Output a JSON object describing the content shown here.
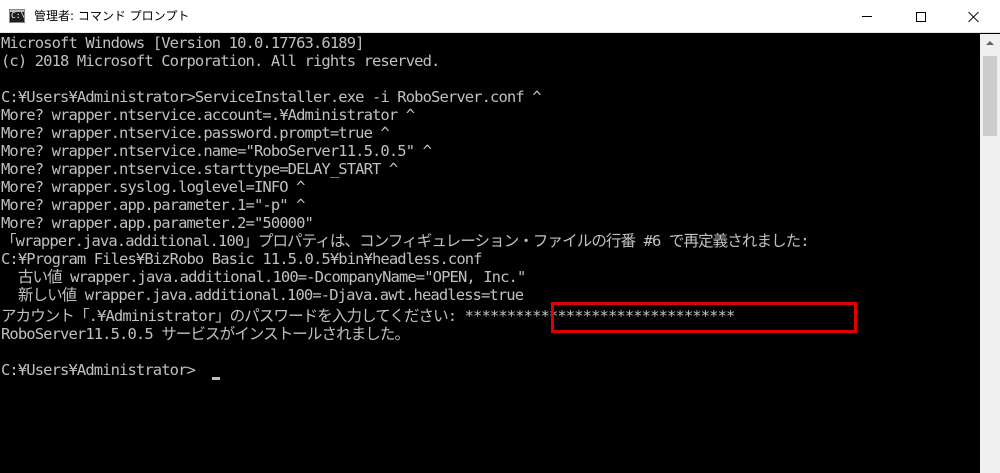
{
  "window": {
    "title": "管理者: コマンド プロンプト",
    "icon_label": "C:\\"
  },
  "console": {
    "lines": [
      "Microsoft Windows [Version 10.0.17763.6189]",
      "(c) 2018 Microsoft Corporation. All rights reserved.",
      "",
      "C:¥Users¥Administrator>ServiceInstaller.exe -i RoboServer.conf ^",
      "More? wrapper.ntservice.account=.¥Administrator ^",
      "More? wrapper.ntservice.password.prompt=true ^",
      "More? wrapper.ntservice.name=\"RoboServer11.5.0.5\" ^",
      "More? wrapper.ntservice.starttype=DELAY_START ^",
      "More? wrapper.syslog.loglevel=INFO ^",
      "More? wrapper.app.parameter.1=\"-p\" ^",
      "More? wrapper.app.parameter.2=\"50000\"",
      "「wrapper.java.additional.100」プロパティは、コンフィギュレーション・ファイルの行番 #6 で再定義されました:",
      "C:¥Program Files¥BizRobo Basic 11.5.0.5¥bin¥headless.conf",
      "  古い値 wrapper.java.additional.100=-DcompanyName=\"OPEN, Inc.\"",
      "  新しい値 wrapper.java.additional.100=-Djava.awt.headless=true",
      "アカウント「.¥Administrator」のパスワードを入力してください: ********************************",
      "RoboServer11.5.0.5 サービスがインストールされました。",
      "",
      "C:¥Users¥Administrator>"
    ]
  },
  "colors": {
    "console_bg": "#000000",
    "console_text": "#c0c0c0",
    "highlight": "#e00000",
    "titlebar_bg": "#ffffff"
  },
  "icons": {
    "minimize": "minimize-icon",
    "maximize": "maximize-icon",
    "close": "close-icon",
    "scroll_up": "chevron-up-icon"
  }
}
